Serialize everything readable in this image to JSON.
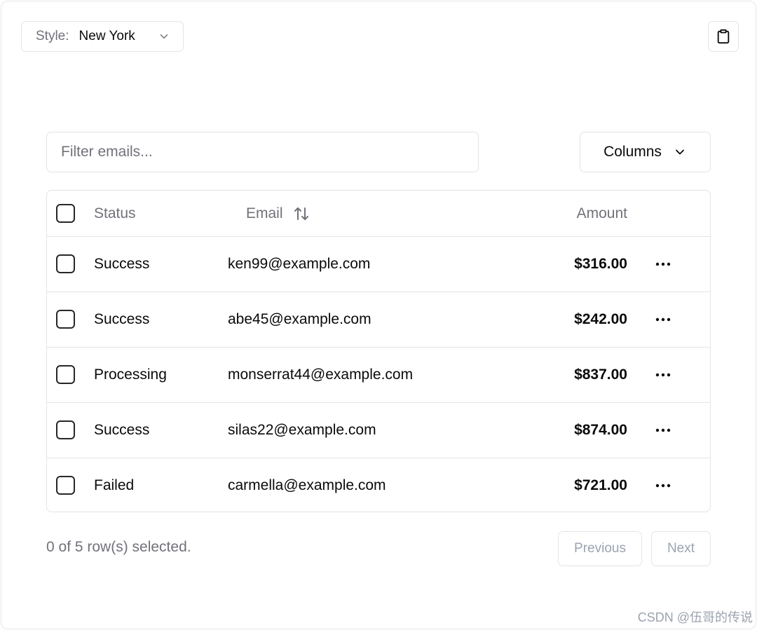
{
  "style_select": {
    "prefix": "Style:",
    "value": "New York"
  },
  "filter": {
    "placeholder": "Filter emails...",
    "value": ""
  },
  "columns_button": {
    "label": "Columns"
  },
  "table": {
    "headers": {
      "status": "Status",
      "email": "Email",
      "amount": "Amount"
    },
    "rows": [
      {
        "status": "Success",
        "email": "ken99@example.com",
        "amount": "$316.00"
      },
      {
        "status": "Success",
        "email": "abe45@example.com",
        "amount": "$242.00"
      },
      {
        "status": "Processing",
        "email": "monserrat44@example.com",
        "amount": "$837.00"
      },
      {
        "status": "Success",
        "email": "silas22@example.com",
        "amount": "$874.00"
      },
      {
        "status": "Failed",
        "email": "carmella@example.com",
        "amount": "$721.00"
      }
    ]
  },
  "footer": {
    "selected_text": "0 of 5 row(s) selected.",
    "previous_label": "Previous",
    "next_label": "Next"
  },
  "watermark": "CSDN @伍哥的传说",
  "icons": [
    "chevron-down-icon",
    "clipboard-icon",
    "sort-arrows-icon",
    "more-horizontal-icon"
  ],
  "colors": {
    "muted_text": "#71717a",
    "border": "#e4e4e7",
    "disabled_text": "#9ca3af"
  }
}
